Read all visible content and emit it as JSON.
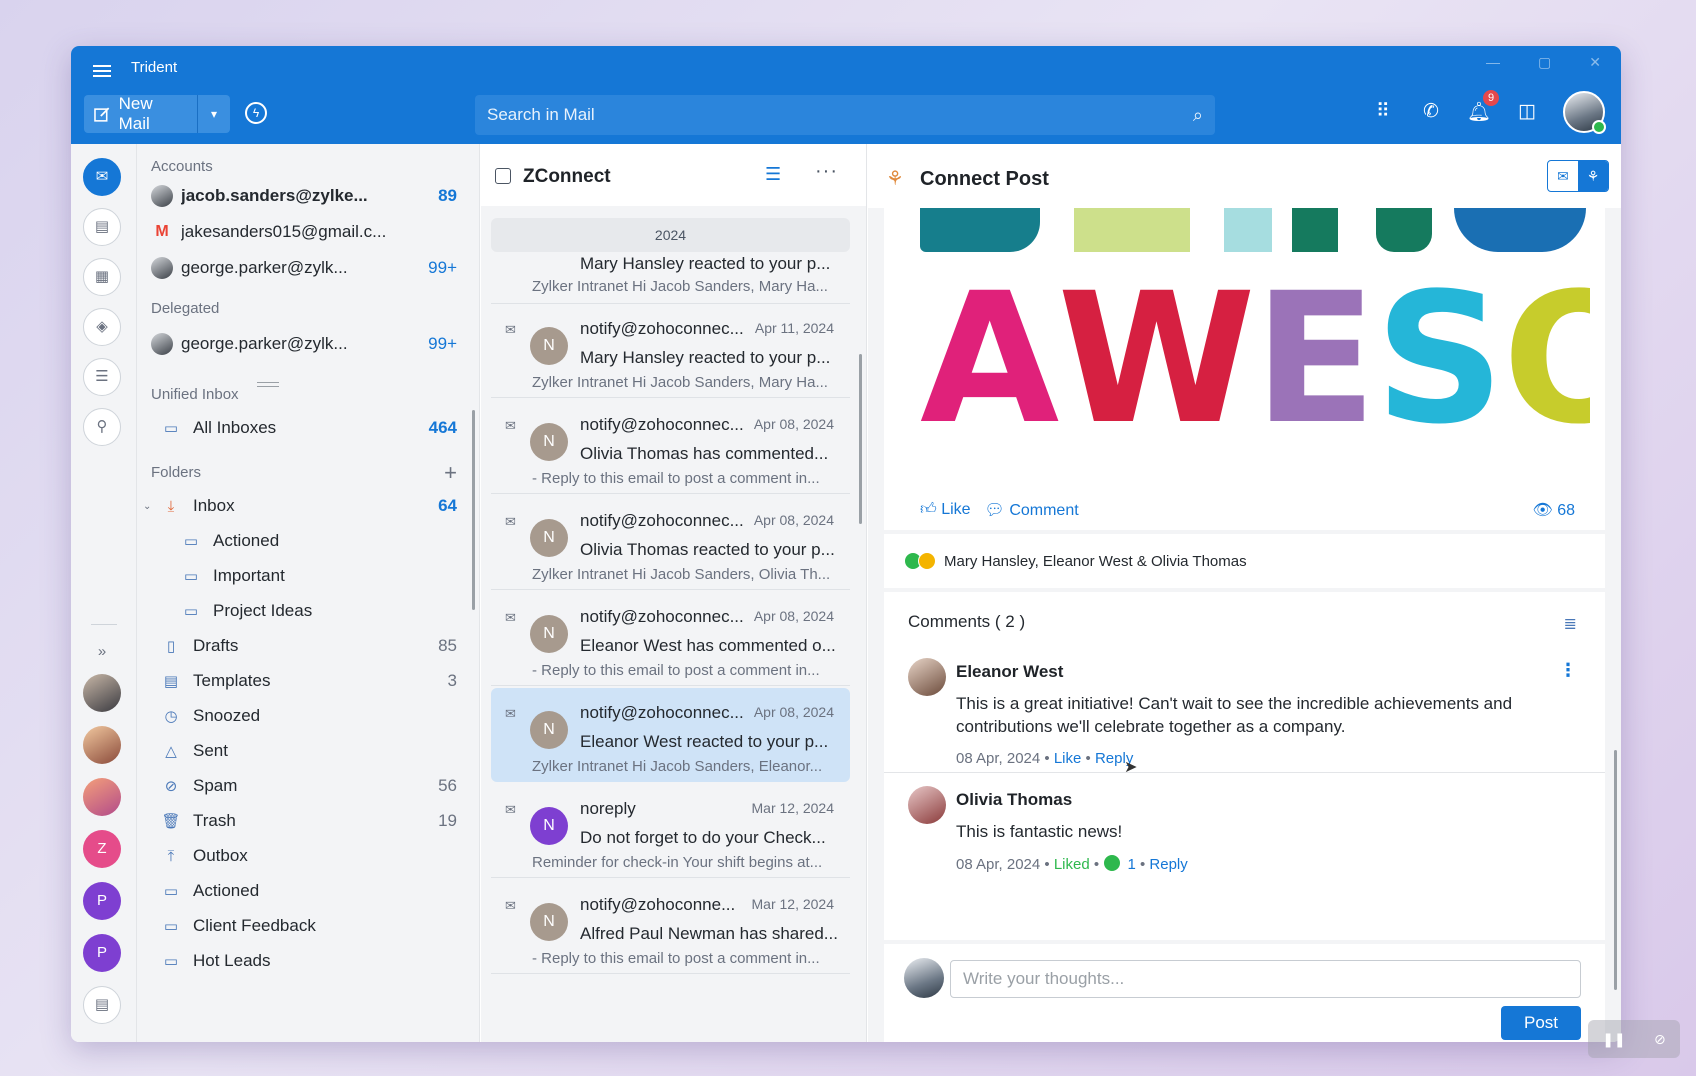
{
  "window": {
    "title": "Trident",
    "controls": [
      "—",
      "▢",
      "✕"
    ]
  },
  "toolbar": {
    "new_mail_label": "New Mail",
    "search_placeholder": "Search in Mail",
    "notification_count": "9"
  },
  "rail": {
    "avatars": [
      "Z",
      "P",
      "P"
    ]
  },
  "accounts": {
    "heading": "Accounts",
    "items": [
      {
        "label": "jacob.sanders@zylke...",
        "count": "89"
      },
      {
        "label": "jakesanders015@gmail.c...",
        "count": ""
      },
      {
        "label": "george.parker@zylk...",
        "count": "99+"
      }
    ]
  },
  "delegated": {
    "heading": "Delegated",
    "items": [
      {
        "label": "george.parker@zylk...",
        "count": "99+"
      }
    ]
  },
  "unified": {
    "heading": "Unified Inbox",
    "all_inboxes": "All Inboxes",
    "all_count": "464"
  },
  "folders": {
    "heading": "Folders",
    "items": [
      {
        "label": "Inbox",
        "count": "64"
      },
      {
        "label": "Actioned",
        "count": ""
      },
      {
        "label": "Important",
        "count": ""
      },
      {
        "label": "Project Ideas",
        "count": ""
      },
      {
        "label": "Drafts",
        "count": "85"
      },
      {
        "label": "Templates",
        "count": "3"
      },
      {
        "label": "Snoozed",
        "count": ""
      },
      {
        "label": "Sent",
        "count": ""
      },
      {
        "label": "Spam",
        "count": "56"
      },
      {
        "label": "Trash",
        "count": "19"
      },
      {
        "label": "Outbox",
        "count": ""
      },
      {
        "label": "Actioned",
        "count": ""
      },
      {
        "label": "Client Feedback",
        "count": ""
      },
      {
        "label": "Hot Leads",
        "count": ""
      }
    ]
  },
  "list": {
    "title": "ZConnect",
    "year": "2024",
    "partial": {
      "subject": "Mary Hansley reacted to your p...",
      "preview": "Zylker Intranet Hi Jacob Sanders, Mary Ha..."
    },
    "mails": [
      {
        "avatar": "N",
        "from": "notify@zohoconnec...",
        "date": "Apr 11, 2024",
        "subject": "Mary Hansley reacted to your p...",
        "preview": "Zylker Intranet Hi Jacob Sanders, Mary Ha..."
      },
      {
        "avatar": "N",
        "from": "notify@zohoconnec...",
        "date": "Apr 08, 2024",
        "subject": "Olivia Thomas has commented...",
        "preview": "- Reply to this email to post a comment in..."
      },
      {
        "avatar": "N",
        "from": "notify@zohoconnec...",
        "date": "Apr 08, 2024",
        "subject": "Olivia Thomas reacted to your p...",
        "preview": "Zylker Intranet Hi Jacob Sanders, Olivia Th..."
      },
      {
        "avatar": "N",
        "from": "notify@zohoconnec...",
        "date": "Apr 08, 2024",
        "subject": "Eleanor West has commented o...",
        "preview": "- Reply to this email to post a comment in..."
      },
      {
        "avatar": "N",
        "from": "notify@zohoconnec...",
        "date": "Apr 08, 2024",
        "subject": "Eleanor West reacted to your p...",
        "preview": "Zylker Intranet Hi Jacob Sanders, Eleanor..."
      },
      {
        "avatar": "N",
        "from": "noreply",
        "date": "Mar 12, 2024",
        "subject": "Do not forget to do your Check...",
        "preview": "Reminder for check-in Your shift begins at..."
      },
      {
        "avatar": "N",
        "from": "notify@zohoconne...",
        "date": "Mar 12, 2024",
        "subject": "Alfred Paul Newman has shared...",
        "preview": "- Reply to this email to post a comment in..."
      }
    ]
  },
  "reader": {
    "title": "Connect Post",
    "artwork_text": "AWESOME",
    "like_label": "Like",
    "comment_label": "Comment",
    "views": "68",
    "reactors": "Mary Hansley, Eleanor West & Olivia Thomas",
    "comments_title": "Comments ( 2 )",
    "comments": [
      {
        "name": "Eleanor West",
        "text": "This is a great initiative! Can't wait to see the incredible achievements and contributions we'll celebrate together as a company.",
        "date": "08 Apr, 2024",
        "like": "Like",
        "reply": "Reply"
      },
      {
        "name": "Olivia Thomas",
        "text": "This is fantastic news!",
        "date": "08 Apr, 2024",
        "like": "Liked",
        "like_count": "1",
        "reply": "Reply"
      }
    ],
    "write_placeholder": "Write your thoughts...",
    "post_label": "Post"
  },
  "colors": {
    "accent": "#1577d6",
    "liked": "#2eb84d",
    "badge": "#e5484d"
  }
}
